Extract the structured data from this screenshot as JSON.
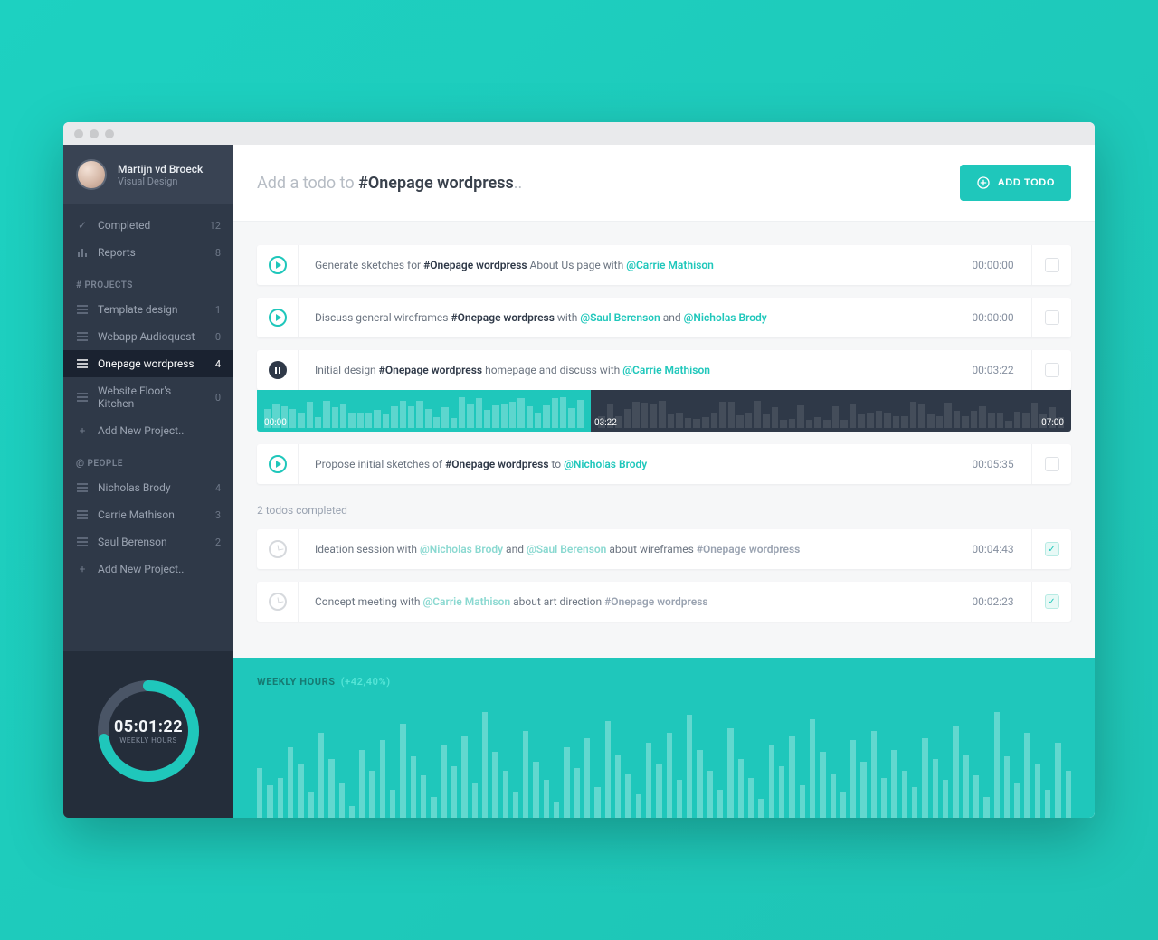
{
  "user": {
    "name": "Martijn vd Broeck",
    "role": "Visual Design"
  },
  "nav": {
    "completed": {
      "label": "Completed",
      "count": "12"
    },
    "reports": {
      "label": "Reports",
      "count": "8"
    }
  },
  "projects_heading": "# PROJECTS",
  "projects": [
    {
      "label": "Template design",
      "count": "1"
    },
    {
      "label": "Webapp Audioquest",
      "count": "0"
    },
    {
      "label": "Onepage wordpress",
      "count": "4"
    },
    {
      "label": "Website Floor's Kitchen",
      "count": "0"
    },
    {
      "label": "Add New Project..",
      "count": ""
    }
  ],
  "people_heading": "@ PEOPLE",
  "people": [
    {
      "label": "Nicholas Brody",
      "count": "4"
    },
    {
      "label": "Carrie Mathison",
      "count": "3"
    },
    {
      "label": "Saul Berenson",
      "count": "2"
    },
    {
      "label": "Add New Project..",
      "count": ""
    }
  ],
  "ring": {
    "value": "05:01:22",
    "label": "WEEKLY HOURS",
    "percent": 72
  },
  "header": {
    "prompt_prefix": "Add a todo to ",
    "prompt_hash": "#Onepage wordpress",
    "prompt_suffix": "..",
    "button": "ADD TODO"
  },
  "todos": [
    {
      "segments": [
        {
          "t": "Generate sketches for "
        },
        {
          "t": "#Onepage wordpress",
          "k": "tag"
        },
        {
          "t": " About Us page with "
        },
        {
          "t": "@Carrie Mathison",
          "k": "at"
        }
      ],
      "time": "00:00:00",
      "state": "play"
    },
    {
      "segments": [
        {
          "t": "Discuss general wireframes "
        },
        {
          "t": "#Onepage wordpress",
          "k": "tag"
        },
        {
          "t": " with "
        },
        {
          "t": "@Saul Berenson",
          "k": "at"
        },
        {
          "t": " and "
        },
        {
          "t": "@Nicholas Brody",
          "k": "at"
        }
      ],
      "time": "00:00:00",
      "state": "play"
    },
    {
      "segments": [
        {
          "t": "Initial design "
        },
        {
          "t": "#Onepage wordpress",
          "k": "tag"
        },
        {
          "t": " homepage and discuss with "
        },
        {
          "t": "@Carrie Mathison",
          "k": "at"
        }
      ],
      "time": "00:03:22",
      "state": "pause"
    },
    {
      "segments": [
        {
          "t": "Propose initial sketches of "
        },
        {
          "t": "#Onepage wordpress",
          "k": "tag"
        },
        {
          "t": " to "
        },
        {
          "t": "@Nicholas Brody",
          "k": "at"
        }
      ],
      "time": "00:05:35",
      "state": "play"
    }
  ],
  "timeline": {
    "start": "00:00",
    "current": "03:22",
    "end": "07:00"
  },
  "completed_heading": "2 todos completed",
  "completed": [
    {
      "segments": [
        {
          "t": "Ideation session with "
        },
        {
          "t": "@Nicholas Brody",
          "k": "at"
        },
        {
          "t": " and "
        },
        {
          "t": "@Saul Berenson",
          "k": "at"
        },
        {
          "t": " about wireframes "
        },
        {
          "t": "#Onepage wordpress",
          "k": "tag"
        }
      ],
      "time": "00:04:43"
    },
    {
      "segments": [
        {
          "t": "Concept meeting with "
        },
        {
          "t": "@Carrie Mathison",
          "k": "at"
        },
        {
          "t": " about art direction "
        },
        {
          "t": "#Onepage wordpress",
          "k": "tag"
        }
      ],
      "time": "00:02:23"
    }
  ],
  "weekly": {
    "title": "WEEKLY HOURS",
    "pct": "(+42,40%)"
  },
  "chart_data": {
    "type": "bar",
    "title": "WEEKLY HOURS (+42,40%)",
    "xlabel": "",
    "ylabel": "",
    "ylim": [
      0,
      100
    ],
    "values": [
      42,
      28,
      34,
      60,
      46,
      22,
      72,
      50,
      30,
      10,
      58,
      40,
      66,
      24,
      80,
      52,
      36,
      18,
      62,
      44,
      70,
      30,
      90,
      56,
      40,
      22,
      74,
      48,
      32,
      14,
      60,
      42,
      68,
      26,
      82,
      54,
      38,
      20,
      64,
      46,
      72,
      32,
      88,
      58,
      40,
      24,
      76,
      50,
      34,
      16,
      62,
      44,
      70,
      28,
      84,
      56,
      38,
      22,
      66,
      48,
      74,
      34,
      58,
      40,
      26,
      68,
      50,
      32,
      78,
      54,
      36,
      18,
      90,
      52,
      30,
      72,
      46,
      24,
      64,
      40
    ]
  }
}
